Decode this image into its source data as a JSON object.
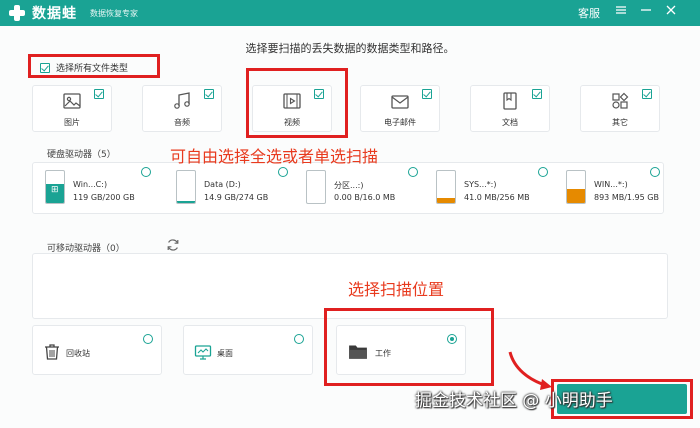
{
  "titlebar": {
    "logo_text": "数据蛙",
    "slogan": "数据恢复专家",
    "service": "客服",
    "menu_icon": "menu-icon",
    "minimize_icon": "minimize-icon",
    "close_icon": "close-icon"
  },
  "instruction": "选择要扫描的丢失数据的数据类型和路径。",
  "select_all": {
    "label": "选择所有文件类型",
    "checked": true
  },
  "file_types": [
    {
      "label": "图片",
      "icon": "image-icon",
      "checked": true
    },
    {
      "label": "音频",
      "icon": "music-icon",
      "checked": true
    },
    {
      "label": "视频",
      "icon": "video-icon",
      "checked": true
    },
    {
      "label": "电子邮件",
      "icon": "email-icon",
      "checked": true
    },
    {
      "label": "文档",
      "icon": "document-icon",
      "checked": true
    },
    {
      "label": "其它",
      "icon": "other-icon",
      "checked": true
    }
  ],
  "hard_drives": {
    "title": "硬盘驱动器（5）",
    "drives": [
      {
        "name": "Win...C:)",
        "size": "119 GB/200 GB",
        "fill_fraction": 0.6,
        "fill_color": "#1aa394"
      },
      {
        "name": "Data (D:)",
        "size": "14.9 GB/274 GB",
        "fill_fraction": 0.05,
        "fill_color": "#1aa394"
      },
      {
        "name": "分区...:)",
        "size": "0.00  B/16.0 MB",
        "fill_fraction": 0.0,
        "fill_color": "#e68a00"
      },
      {
        "name": "SYS...*:)",
        "size": "41.0 MB/256 MB",
        "fill_fraction": 0.16,
        "fill_color": "#e68a00"
      },
      {
        "name": "WIN...*:)",
        "size": "893 MB/1.95 GB",
        "fill_fraction": 0.45,
        "fill_color": "#e68a00"
      }
    ]
  },
  "removable": {
    "title": "可移动驱动器（0）",
    "refresh_icon": "refresh-icon"
  },
  "locations": [
    {
      "label": "回收站",
      "icon": "trash-icon",
      "selected": false
    },
    {
      "label": "桌面",
      "icon": "desktop-icon",
      "selected": false
    },
    {
      "label": "工作",
      "icon": "folder-icon",
      "selected": true
    }
  ],
  "annotations": {
    "free_select": "可自由选择全选或者单选扫描",
    "select_location": "选择扫描位置"
  },
  "watermark": "掘金技术社区 @ 小明助手",
  "colors": {
    "accent": "#1aa394",
    "annotation_red": "#e02020",
    "warning_orange": "#e68a00"
  }
}
